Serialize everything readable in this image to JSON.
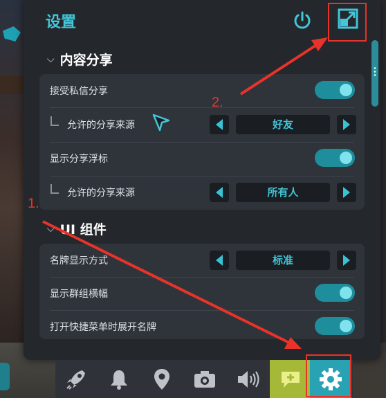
{
  "panel": {
    "title": "设置",
    "power_icon": "power-icon",
    "expand_icon": "expand-icon"
  },
  "sections": {
    "content_share": {
      "title": "内容分享",
      "rows": {
        "accept_private": {
          "label": "接受私信分享",
          "enabled": true
        },
        "allowed_source_1": {
          "label": "允许的分享来源",
          "value": "好友"
        },
        "show_float": {
          "label": "显示分享浮标",
          "enabled": true
        },
        "allowed_source_2": {
          "label": "允许的分享来源",
          "value": "所有人"
        }
      }
    },
    "ui_widgets": {
      "title": "UI 组件",
      "rows": {
        "nameplate_mode": {
          "label": "名牌显示方式",
          "value": "标准"
        },
        "show_group_banner": {
          "label": "显示群组横幅",
          "enabled": true
        },
        "expand_nameplate": {
          "label": "打开快捷菜单时展开名牌",
          "enabled": true
        }
      }
    }
  },
  "toolbar": {
    "items": [
      "rocket-icon",
      "bell-icon",
      "map-pin-icon",
      "camera-icon",
      "speaker-icon",
      "chat-plus-icon",
      "gear-icon"
    ],
    "active": "gear-icon"
  },
  "annotations": {
    "step1": "1.",
    "step2": "2."
  },
  "colors": {
    "accent": "#42c6d8",
    "toggle_on": "#1f8e9c",
    "annotation": "#e8332a",
    "chat_button": "#a5b838",
    "settings_button": "#29a3b3"
  }
}
